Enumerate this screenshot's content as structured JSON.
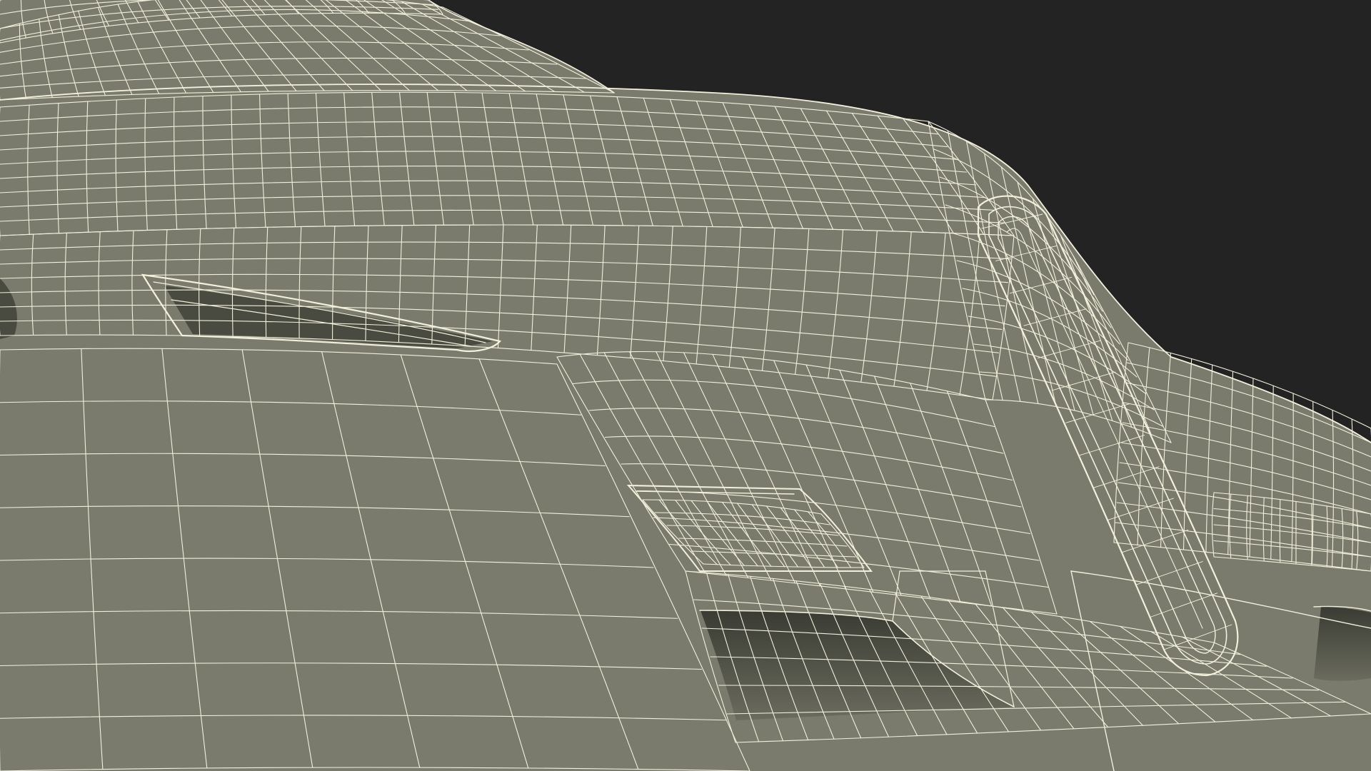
{
  "scene": {
    "background_color": "#232323",
    "surface_color": "#7a7b6c",
    "surface_shadow_color": "#5c5d50",
    "cavity_color": "#45463c",
    "wire_color": "#f2f0dc"
  }
}
